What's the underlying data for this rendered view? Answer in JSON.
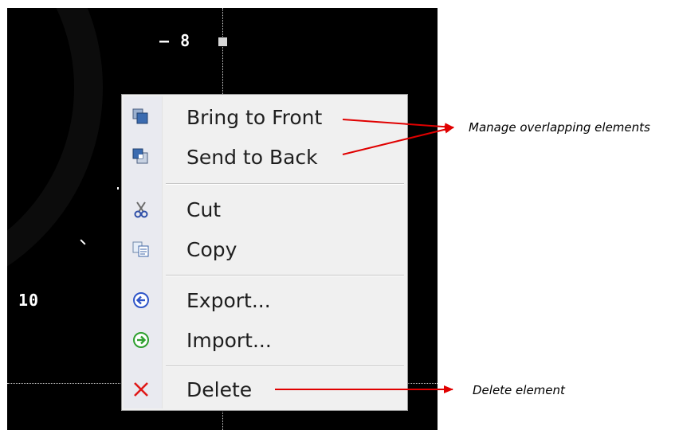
{
  "canvas": {
    "labels": {
      "upper": "8",
      "left": "10"
    }
  },
  "context_menu": {
    "items": [
      {
        "label": "Bring to Front",
        "icon": "bring-to-front-icon"
      },
      {
        "label": "Send to Back",
        "icon": "send-to-back-icon"
      },
      {
        "label": "Cut",
        "icon": "scissors-icon"
      },
      {
        "label": "Copy",
        "icon": "copy-icon"
      },
      {
        "label": "Export...",
        "icon": "export-arrow-icon"
      },
      {
        "label": "Import...",
        "icon": "import-arrow-icon"
      },
      {
        "label": "Delete",
        "icon": "delete-x-icon"
      }
    ]
  },
  "annotations": {
    "overlap": "Manage overlapping elements",
    "delete": "Delete element"
  },
  "colors": {
    "canvas_bg": "#000000",
    "menu_bg": "#f0f0f0",
    "callout_arrow": "#e00000",
    "export_icon": "#2f55c8",
    "import_icon": "#2fa02f",
    "delete_icon": "#e01818"
  }
}
